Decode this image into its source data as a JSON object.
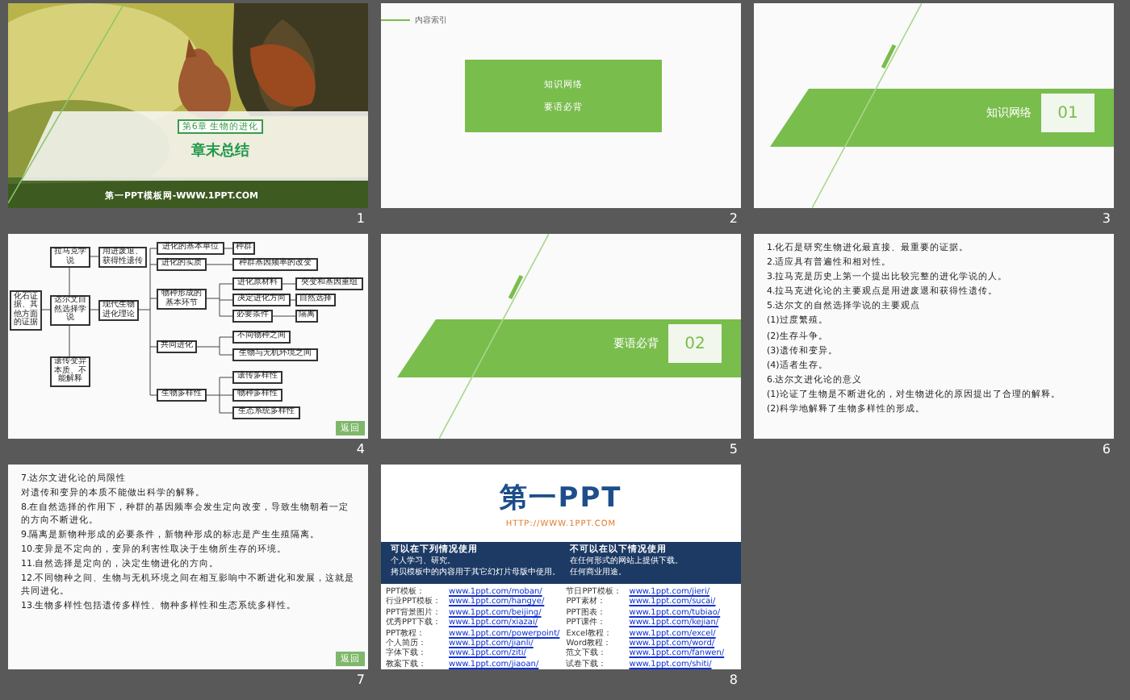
{
  "slides": [
    {
      "kind": "cover",
      "number": "1",
      "badge": "第6章 生物的进化",
      "title": "章末总结",
      "footer": "第一PPT模板网-WWW.1PPT.COM"
    },
    {
      "kind": "index",
      "number": "2",
      "heading": "内容索引",
      "items": [
        "知识网络",
        "要语必背"
      ]
    },
    {
      "kind": "section",
      "number": "3",
      "title": "知识网络",
      "index": "01"
    },
    {
      "kind": "concept_map",
      "number": "4",
      "back_button": "返回",
      "nodes": [
        "化石证据、其他方面的证据",
        "拉马克学说",
        "用进废退、获得性遗传",
        "达尔文自然选择学说",
        "遗传变异本质、不能解释",
        "现代生物进化理论",
        "进化的基本单位",
        "种群",
        "进化的实质",
        "种群基因频率的改变",
        "物种形成的基本环节",
        "进化原材料",
        "突变和基因重组",
        "决定进化方向",
        "自然选择",
        "必要条件",
        "隔离",
        "共同进化",
        "不同物种之间",
        "生物与无机环境之间",
        "生物多样性",
        "遗传多样性",
        "物种多样性",
        "生态系统多样性"
      ]
    },
    {
      "kind": "section",
      "number": "5",
      "title": "要语必背",
      "index": "02"
    },
    {
      "kind": "text",
      "number": "6",
      "lines": [
        "1.化石是研究生物进化最直接、最重要的证据。",
        "2.适应具有普遍性和相对性。",
        "3.拉马克是历史上第一个提出比较完整的进化学说的人。",
        "4.拉马克进化论的主要观点是用进废退和获得性遗传。",
        "5.达尔文的自然选择学说的主要观点",
        "(1)过度繁殖。",
        "(2)生存斗争。",
        "(3)遗传和变异。",
        "(4)适者生存。",
        "6.达尔文进化论的意义",
        "(1)论证了生物是不断进化的，对生物进化的原因提出了合理的解释。",
        "(2)科学地解释了生物多样性的形成。"
      ]
    },
    {
      "kind": "text",
      "number": "7",
      "back_button": "返回",
      "lines": [
        "7.达尔文进化论的局限性",
        "对遗传和变异的本质不能做出科学的解释。",
        "8.在自然选择的作用下，种群的基因频率会发生定向改变，导致生物朝着一定的方向不断进化。",
        "9.隔离是新物种形成的必要条件，新物种形成的标志是产生生殖隔离。",
        "10.变异是不定向的，变异的利害性取决于生物所生存的环境。",
        "11.自然选择是定向的，决定生物进化的方向。",
        "12.不同物种之间、生物与无机环境之间在相互影响中不断进化和发展，这就是共同进化。",
        "13.生物多样性包括遗传多样性、物种多样性和生态系统多样性。"
      ]
    },
    {
      "kind": "links",
      "number": "8",
      "logo": "第一PPT",
      "url": "HTTP://WWW.1PPT.COM",
      "allowed": {
        "title": "可以在下列情况使用",
        "items": [
          "个人学习、研究。",
          "拷贝模板中的内容用于其它幻灯片母版中使用。"
        ]
      },
      "forbidden": {
        "title": "不可以在以下情况使用",
        "items": [
          "在任何形式的网站上提供下载。",
          "任何商业用途。"
        ]
      },
      "links_left": [
        {
          "label": "PPT模板：",
          "url": "www.1ppt.com/moban/"
        },
        {
          "label": "行业PPT模板：",
          "url": "www.1ppt.com/hangye/"
        },
        {
          "label": "PPT背景图片：",
          "url": "www.1ppt.com/beijing/"
        },
        {
          "label": "优秀PPT下载：",
          "url": "www.1ppt.com/xiazai/"
        },
        {
          "label": "PPT教程：",
          "url": "www.1ppt.com/powerpoint/"
        },
        {
          "label": "个人简历：",
          "url": "www.1ppt.com/jianli/"
        },
        {
          "label": "字体下载：",
          "url": "www.1ppt.com/ziti/"
        },
        {
          "label": "教案下载：",
          "url": "www.1ppt.com/jiaoan/"
        }
      ],
      "links_right": [
        {
          "label": "节日PPT模板：",
          "url": "www.1ppt.com/jieri/"
        },
        {
          "label": "PPT素材：",
          "url": "www.1ppt.com/sucai/"
        },
        {
          "label": "PPT图表：",
          "url": "www.1ppt.com/tubiao/"
        },
        {
          "label": "PPT课件：",
          "url": "www.1ppt.com/kejian/"
        },
        {
          "label": "Excel教程：",
          "url": "www.1ppt.com/excel/"
        },
        {
          "label": "Word教程：",
          "url": "www.1ppt.com/word/"
        },
        {
          "label": "范文下载：",
          "url": "www.1ppt.com/fanwen/"
        },
        {
          "label": "试卷下载：",
          "url": "www.1ppt.com/shiti/"
        }
      ]
    }
  ]
}
